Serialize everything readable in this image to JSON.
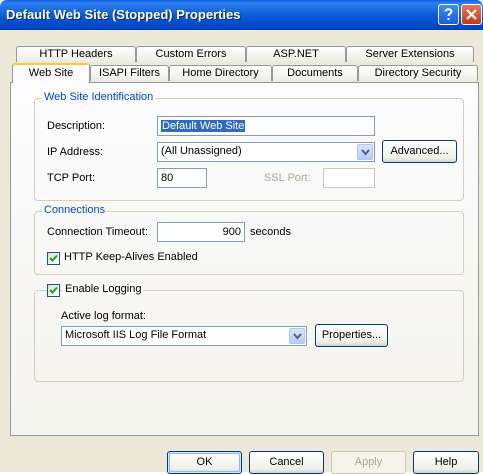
{
  "window": {
    "title": "Default Web Site (Stopped) Properties"
  },
  "tabs_row_back": [
    "HTTP Headers",
    "Custom Errors",
    "ASP.NET",
    "Server Extensions"
  ],
  "tabs_row_front": [
    "Web Site",
    "ISAPI Filters",
    "Home Directory",
    "Documents",
    "Directory Security"
  ],
  "identification": {
    "group_label": "Web Site Identification",
    "description_label": "Description:",
    "description_value": "Default Web Site",
    "ip_label": "IP Address:",
    "ip_value": "(All Unassigned)",
    "advanced_button": "Advanced...",
    "tcp_label": "TCP Port:",
    "tcp_value": "80",
    "ssl_label": "SSL Port:",
    "ssl_value": ""
  },
  "connections": {
    "group_label": "Connections",
    "timeout_label": "Connection Timeout:",
    "timeout_value": "900",
    "timeout_unit": "seconds",
    "keepalive_label": "HTTP Keep-Alives Enabled",
    "keepalive_checked": true
  },
  "logging": {
    "enable_label": "Enable Logging",
    "enable_checked": true,
    "format_label": "Active log format:",
    "format_value": "Microsoft IIS Log File Format",
    "properties_button": "Properties..."
  },
  "buttons": {
    "ok": "OK",
    "cancel": "Cancel",
    "apply": "Apply",
    "help": "Help"
  }
}
